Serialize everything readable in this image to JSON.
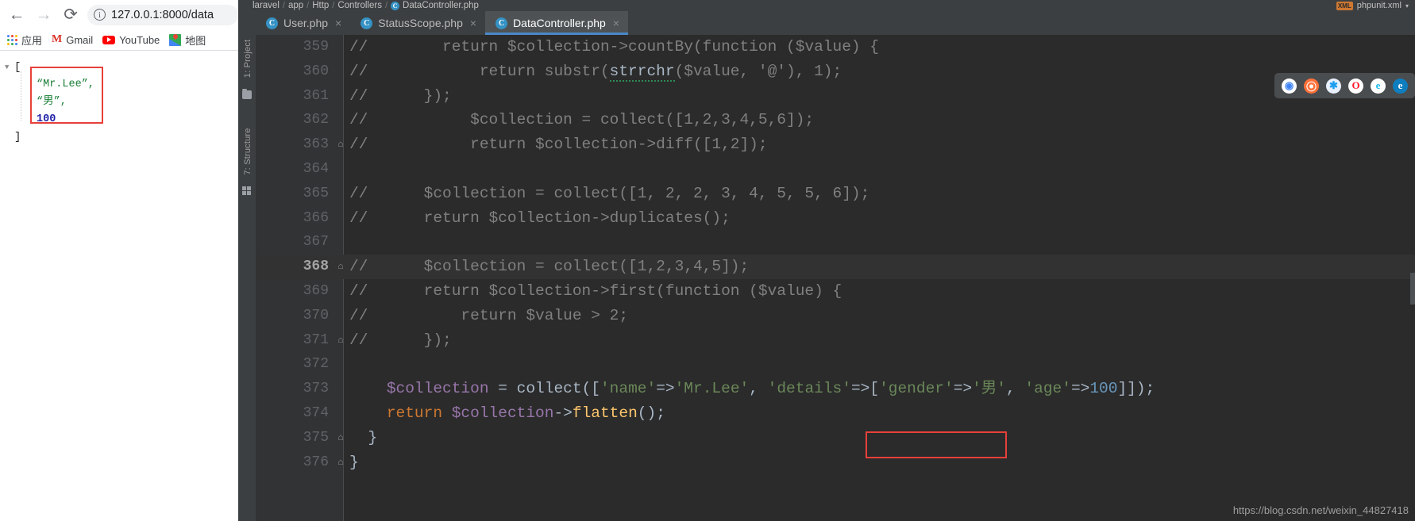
{
  "browser": {
    "nav": {
      "back": "←",
      "forward": "→",
      "reload": "⟳"
    },
    "omnibox": {
      "info_icon": "i",
      "url": "127.0.0.1:8000/data"
    },
    "bookmarks": [
      {
        "icon": "apps-grid-icon",
        "label": "应用"
      },
      {
        "icon": "gmail-icon",
        "label": "Gmail"
      },
      {
        "icon": "youtube-icon",
        "label": "YouTube"
      },
      {
        "icon": "google-maps-icon",
        "label": "地图"
      }
    ],
    "json_view": {
      "triangle": "▼",
      "open_bracket": "[",
      "close_bracket": "]",
      "lines": [
        {
          "text": "“Mr.Lee”,",
          "type": "string"
        },
        {
          "text": "“男”,",
          "type": "string"
        },
        {
          "text": "100",
          "type": "number"
        }
      ],
      "highlight_color": "#e8403a"
    }
  },
  "ide": {
    "breadcrumb": {
      "items": [
        "laravel",
        "app",
        "Http",
        "Controllers"
      ],
      "separator": "/",
      "file": "DataController.php",
      "file_icon": "php-class-icon"
    },
    "topright": {
      "badge": "XML",
      "config_name": "phpunit.xml",
      "chevron": "▾"
    },
    "tabs": [
      {
        "label": "User.php",
        "icon": "php-class-icon",
        "close": "×",
        "active": false
      },
      {
        "label": "StatusScope.php",
        "icon": "php-class-icon",
        "close": "×",
        "active": false
      },
      {
        "label": "DataController.php",
        "icon": "php-class-icon",
        "close": "×",
        "active": true
      }
    ],
    "tool_windows": [
      {
        "label": "1: Project",
        "icon": "folder-icon"
      },
      {
        "label": "7: Structure",
        "icon": "grid-icon"
      }
    ],
    "browser_strip_icons": [
      {
        "name": "chrome-icon",
        "color": "#4285f4"
      },
      {
        "name": "firefox-icon",
        "color": "#ff7139"
      },
      {
        "name": "safari-icon",
        "color": "#1b9df0"
      },
      {
        "name": "opera-icon",
        "color": "#ff1b2d"
      },
      {
        "name": "ie-icon",
        "color": "#1ebbee"
      },
      {
        "name": "edge-icon",
        "color": "#0f7ebf"
      }
    ],
    "annotation_color": "#e8403a",
    "watermark": "https://blog.csdn.net/weixin_44827418",
    "editor": {
      "current_line": 368,
      "lines": [
        {
          "num": "359",
          "fold": "",
          "tokens": [
            {
              "t": "//",
              "c": "cmt"
            },
            {
              "t": "        return $collection->countBy(function ($value) {",
              "c": "cmt"
            }
          ]
        },
        {
          "num": "360",
          "fold": "",
          "tokens": [
            {
              "t": "//",
              "c": "cmt"
            },
            {
              "t": "            return substr(",
              "c": "cmt"
            },
            {
              "t": "strrchr",
              "c": "err"
            },
            {
              "t": "($value, '@'), 1);",
              "c": "cmt"
            }
          ]
        },
        {
          "num": "361",
          "fold": "",
          "tokens": [
            {
              "t": "//",
              "c": "cmt"
            },
            {
              "t": "      });",
              "c": "cmt"
            }
          ]
        },
        {
          "num": "362",
          "fold": "",
          "tokens": [
            {
              "t": "//",
              "c": "cmt"
            },
            {
              "t": "           $collection = collect([1,2,3,4,5,6]);",
              "c": "cmt"
            }
          ]
        },
        {
          "num": "363",
          "fold": "⌂",
          "tokens": [
            {
              "t": "//",
              "c": "cmt"
            },
            {
              "t": "           return $collection->diff([1,2]);",
              "c": "cmt"
            }
          ]
        },
        {
          "num": "364",
          "fold": "",
          "tokens": []
        },
        {
          "num": "365",
          "fold": "",
          "tokens": [
            {
              "t": "//",
              "c": "cmt"
            },
            {
              "t": "      $collection = collect([1, 2, 2, 3, 4, 5, 5, 6]);",
              "c": "cmt"
            }
          ]
        },
        {
          "num": "366",
          "fold": "",
          "tokens": [
            {
              "t": "//",
              "c": "cmt"
            },
            {
              "t": "      return $collection->duplicates();",
              "c": "cmt"
            }
          ]
        },
        {
          "num": "367",
          "fold": "",
          "tokens": []
        },
        {
          "num": "368",
          "fold": "⌂",
          "tokens": [
            {
              "t": "//",
              "c": "cmt"
            },
            {
              "t": "      $collection = collect([1,2,3,4,5]);",
              "c": "cmt"
            }
          ]
        },
        {
          "num": "369",
          "fold": "",
          "tokens": [
            {
              "t": "//",
              "c": "cmt"
            },
            {
              "t": "      return $collection->first(function ($value) {",
              "c": "cmt"
            }
          ]
        },
        {
          "num": "370",
          "fold": "",
          "tokens": [
            {
              "t": "//",
              "c": "cmt"
            },
            {
              "t": "          return $value > 2;",
              "c": "cmt"
            }
          ]
        },
        {
          "num": "371",
          "fold": "⌂",
          "tokens": [
            {
              "t": "//",
              "c": "cmt"
            },
            {
              "t": "      });",
              "c": "cmt"
            }
          ]
        },
        {
          "num": "372",
          "fold": "",
          "tokens": []
        },
        {
          "num": "373",
          "fold": "",
          "tokens": [
            {
              "t": "    ",
              "c": "def"
            },
            {
              "t": "$collection",
              "c": "var"
            },
            {
              "t": " = ",
              "c": "def"
            },
            {
              "t": "collect",
              "c": "def"
            },
            {
              "t": "([",
              "c": "def"
            },
            {
              "t": "'name'",
              "c": "str"
            },
            {
              "t": "=>",
              "c": "def"
            },
            {
              "t": "'Mr.Lee'",
              "c": "str"
            },
            {
              "t": ", ",
              "c": "def"
            },
            {
              "t": "'details'",
              "c": "str"
            },
            {
              "t": "=>[",
              "c": "def"
            },
            {
              "t": "'gender'",
              "c": "str"
            },
            {
              "t": "=>",
              "c": "def"
            },
            {
              "t": "'男'",
              "c": "str"
            },
            {
              "t": ", ",
              "c": "def"
            },
            {
              "t": "'age'",
              "c": "str"
            },
            {
              "t": "=>",
              "c": "def"
            },
            {
              "t": "100",
              "c": "num"
            },
            {
              "t": "]]);",
              "c": "def"
            }
          ]
        },
        {
          "num": "374",
          "fold": "",
          "tokens": [
            {
              "t": "    ",
              "c": "def"
            },
            {
              "t": "return",
              "c": "kw"
            },
            {
              "t": " ",
              "c": "def"
            },
            {
              "t": "$collection",
              "c": "var"
            },
            {
              "t": "->",
              "c": "def"
            },
            {
              "t": "flatten",
              "c": "fn"
            },
            {
              "t": "();",
              "c": "def"
            }
          ]
        },
        {
          "num": "375",
          "fold": "⌂",
          "tokens": [
            {
              "t": "  }",
              "c": "def"
            }
          ]
        },
        {
          "num": "376",
          "fold": "⌂",
          "tokens": [
            {
              "t": "}",
              "c": "def"
            }
          ]
        }
      ]
    }
  }
}
